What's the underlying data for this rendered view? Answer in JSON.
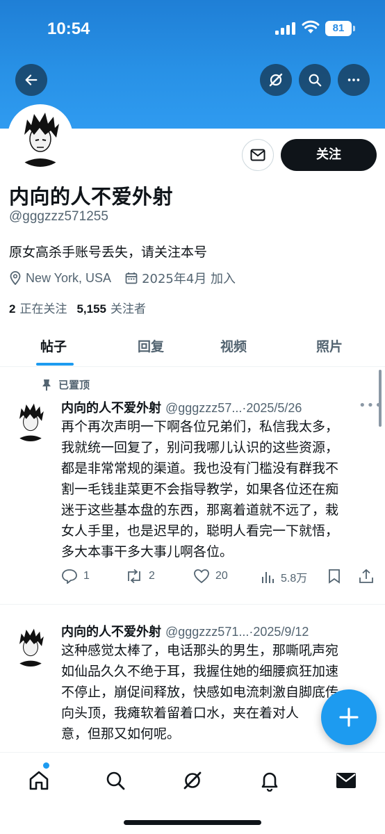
{
  "status_bar": {
    "time": "10:54",
    "battery": "81"
  },
  "profile": {
    "name": "内向的人不爱外射",
    "handle": "@gggzzz571255",
    "bio": "原女高杀手账号丢失，请关注本号",
    "location": "New York, USA",
    "joined": "2025年4月 加入",
    "following_count": "2",
    "following_label": "正在关注",
    "followers_count": "5,155",
    "followers_label": "关注者",
    "follow_label": "关注"
  },
  "tabs": [
    {
      "label": "帖子"
    },
    {
      "label": "回复"
    },
    {
      "label": "视频"
    },
    {
      "label": "照片"
    }
  ],
  "posts": [
    {
      "pinned_label": "已置顶",
      "author": "内向的人不爱外射",
      "handle": "@gggzzz57...",
      "date": "·2025/5/26",
      "lines": [
        "再个再次声明一下啊各位兄弟们，私信我太多，",
        "我就统一回复了，别问我哪儿认识的这些资源，",
        "都是非常常规的渠道。我也没有门槛没有群我不",
        "割一毛钱韭菜更不会指导教学，如果各位还在痴",
        "迷于这些基本盘的东西，那离着道就不远了，栽",
        "女人手里，也是迟早的，聪明人看完一下就悟，",
        "多大本事干多大事儿啊各位。"
      ],
      "replies": "1",
      "reposts": "2",
      "likes": "20",
      "views": "5.8万"
    },
    {
      "author": "内向的人不爱外射",
      "handle": "@gggzzz571...",
      "date": "·2025/9/12",
      "lines": [
        "这种感觉太棒了，电话那头的男生，那嘶吼声宛",
        "如仙品久久不绝于耳，我握住她的细腰疯狂加速",
        "不停止，崩促间释放，快感如电流刺激自脚底传",
        "向头顶，我瘫软着留着口水，夹在着对人",
        "意，但那又如何呢。"
      ]
    }
  ],
  "colors": {
    "accent": "#1d9bf0",
    "header": "#2891e6",
    "text": "#0f1419",
    "muted": "#536471"
  }
}
